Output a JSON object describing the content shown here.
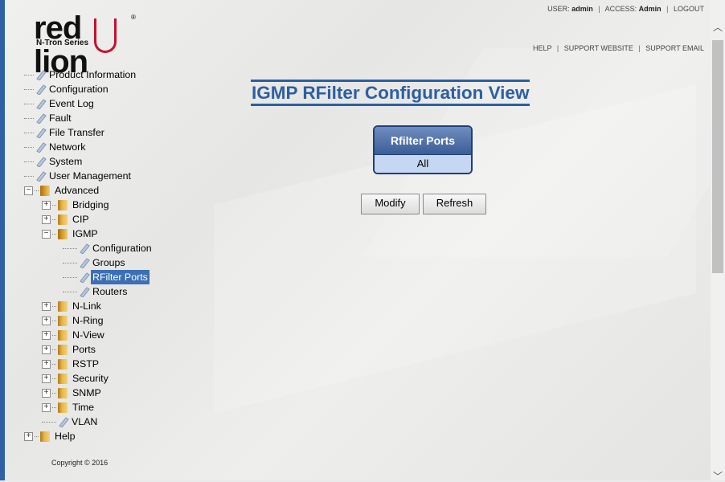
{
  "header": {
    "logo_text": "red lion",
    "logo_sub": "N-Tron Series",
    "user_label": "USER:",
    "user_value": "admin",
    "access_label": "ACCESS:",
    "access_value": "Admin",
    "logout": "LOGOUT",
    "help": "HELP",
    "support_website": "SUPPORT WEBSITE",
    "support_email": "SUPPORT EMAIL"
  },
  "tree": {
    "product_information": "Product Information",
    "configuration": "Configuration",
    "event_log": "Event Log",
    "fault": "Fault",
    "file_transfer": "File Transfer",
    "network": "Network",
    "system": "System",
    "user_management": "User Management",
    "advanced": "Advanced",
    "bridging": "Bridging",
    "cip": "CIP",
    "igmp": "IGMP",
    "igmp_configuration": "Configuration",
    "igmp_groups": "Groups",
    "igmp_rfilter_ports": "RFilter Ports",
    "igmp_routers": "Routers",
    "nlink": "N-Link",
    "nring": "N-Ring",
    "nview": "N-View",
    "ports": "Ports",
    "rstp": "RSTP",
    "security": "Security",
    "snmp": "SNMP",
    "time": "Time",
    "vlan": "VLAN",
    "help": "Help"
  },
  "copyright": "Copyright © 2016",
  "main": {
    "title": "IGMP RFilter Configuration View",
    "table_header": "Rfilter Ports",
    "table_value": "All",
    "modify_label": "Modify",
    "refresh_label": "Refresh"
  },
  "colors": {
    "accent": "#2b5fa3",
    "selection": "#3c6fb5",
    "table_header": "#4b6ea4",
    "table_cell": "#c5d7f2",
    "logo_red": "#c8102e"
  }
}
